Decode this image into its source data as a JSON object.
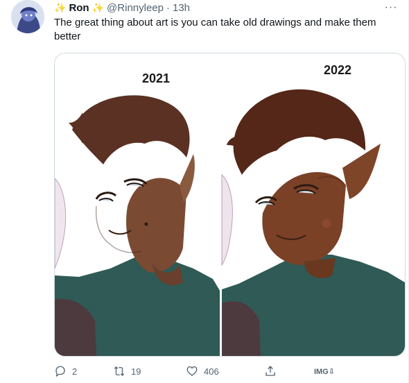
{
  "tweet": {
    "display_name": "Ron",
    "handle": "@Rinnyleep",
    "separator": "·",
    "time": "13h",
    "text": "The great thing about art is you can take old drawings and make them better",
    "more_label": "···"
  },
  "media": {
    "left_year": "2021",
    "right_year": "2022"
  },
  "actions": {
    "replies": "2",
    "retweets": "19",
    "likes": "406",
    "img_label": "IMG⇩"
  },
  "colors": {
    "text": "#0f1419",
    "secondary": "#536471",
    "border": "#cfd9de",
    "sparkle": "#f5b301"
  }
}
